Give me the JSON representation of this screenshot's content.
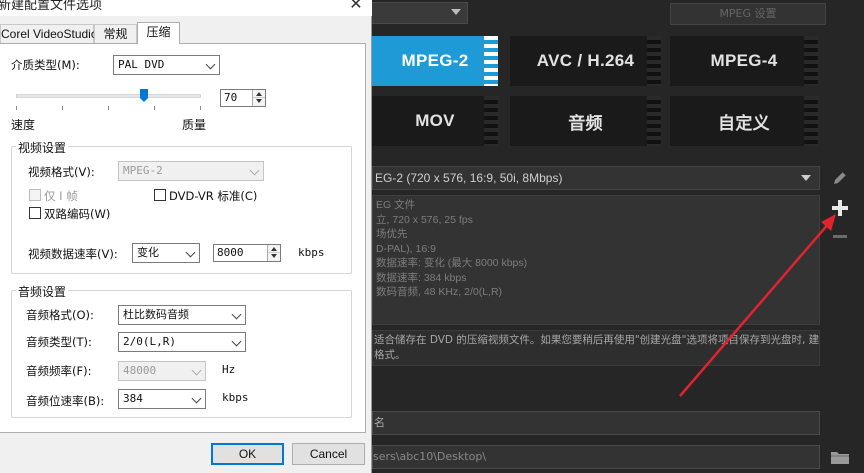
{
  "dialog": {
    "title": "新建配置文件选项",
    "tabs": [
      {
        "label": "Corel VideoStudio"
      },
      {
        "label": "常规"
      },
      {
        "label": "压缩"
      }
    ],
    "media_type": {
      "label": "介质类型(M):",
      "value": "PAL DVD"
    },
    "quality_slider": {
      "value": 70,
      "label_left": "速度",
      "label_right": "质量"
    },
    "video": {
      "group_title": "视频设置",
      "format_label": "视频格式(V):",
      "format_value": "MPEG-2",
      "i_frame_only": "仅 I 帧",
      "dvd_vr": "DVD-VR 标准(C)",
      "dual_pass": "双路编码(W)",
      "bitrate_label": "视频数据速率(V):",
      "bitrate_mode": "变化",
      "bitrate_value": "8000",
      "bitrate_unit": "kbps"
    },
    "audio": {
      "group_title": "音频设置",
      "format_label": "音频格式(O):",
      "format_value": "杜比数码音频",
      "type_label": "音频类型(T):",
      "type_value": "2/0(L,R)",
      "rate_label": "音频频率(F):",
      "rate_value": "48000",
      "rate_unit": "Hz",
      "bitrate_label": "音频位速率(B):",
      "bitrate_value": "384",
      "bitrate_unit": "kbps"
    },
    "ok_label": "OK",
    "cancel_label": "Cancel"
  },
  "app": {
    "top_right_button": "MPEG 设置",
    "formats": [
      {
        "label": "MPEG-2",
        "active": true
      },
      {
        "label": "AVC / H.264"
      },
      {
        "label": "MPEG-4"
      },
      {
        "label": "MOV"
      },
      {
        "label": "音频"
      },
      {
        "label": "自定义"
      }
    ],
    "profile_select": "EG-2 (720 x 576, 16:9, 50i, 8Mbps)",
    "profile_info_lines": [
      "EG 文件",
      "立, 720 x 576, 25 fps",
      "场优先",
      "D-PAL), 16:9",
      "数据速率: 变化 (最大  8000 kbps)",
      "数据速率: 384 kbps",
      "数码音频, 48 KHz, 2/0(L,R)"
    ],
    "description_lines": [
      "适合储存在 DVD 的压缩视频文件。如果您要稍后再使用\"创建光盘\"选项将项目保存到光盘时, 建议使",
      "格式。"
    ],
    "name_field": "名",
    "path_field": "sers\\abc10\\Desktop\\"
  },
  "colors": {
    "accent": "#1e9bd7",
    "arrow": "#e0242f"
  }
}
